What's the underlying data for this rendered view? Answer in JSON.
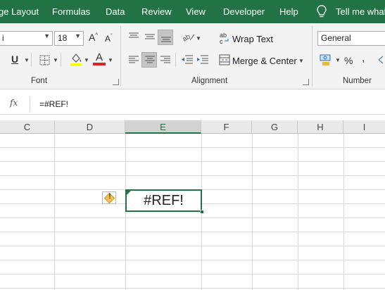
{
  "menu": [
    "ge Layout",
    "Formulas",
    "Data",
    "Review",
    "View",
    "Developer",
    "Help",
    "Tell me what"
  ],
  "ribbon": {
    "font": {
      "font_name": "i",
      "font_size": "18",
      "grow_label": "A",
      "shrink_label": "A",
      "underline_label": "U",
      "font_color_label": "A",
      "group_label": "Font"
    },
    "alignment": {
      "wrap_text": "Wrap Text",
      "merge_center": "Merge & Center",
      "group_label": "Alignment"
    },
    "number": {
      "format": "General",
      "percent": "%",
      "comma": ",",
      "group_label": "Number"
    },
    "colors": {
      "accent": "#217346",
      "fill_highlight": "#ffff00",
      "font_red": "#e02020"
    }
  },
  "formula_bar": {
    "fx": "fx",
    "formula": "=#REF!"
  },
  "columns": [
    "C",
    "D",
    "E",
    "F",
    "G",
    "H",
    "I"
  ],
  "active_cell": {
    "column": "E",
    "value": "#REF!"
  },
  "warning_icon": "!"
}
